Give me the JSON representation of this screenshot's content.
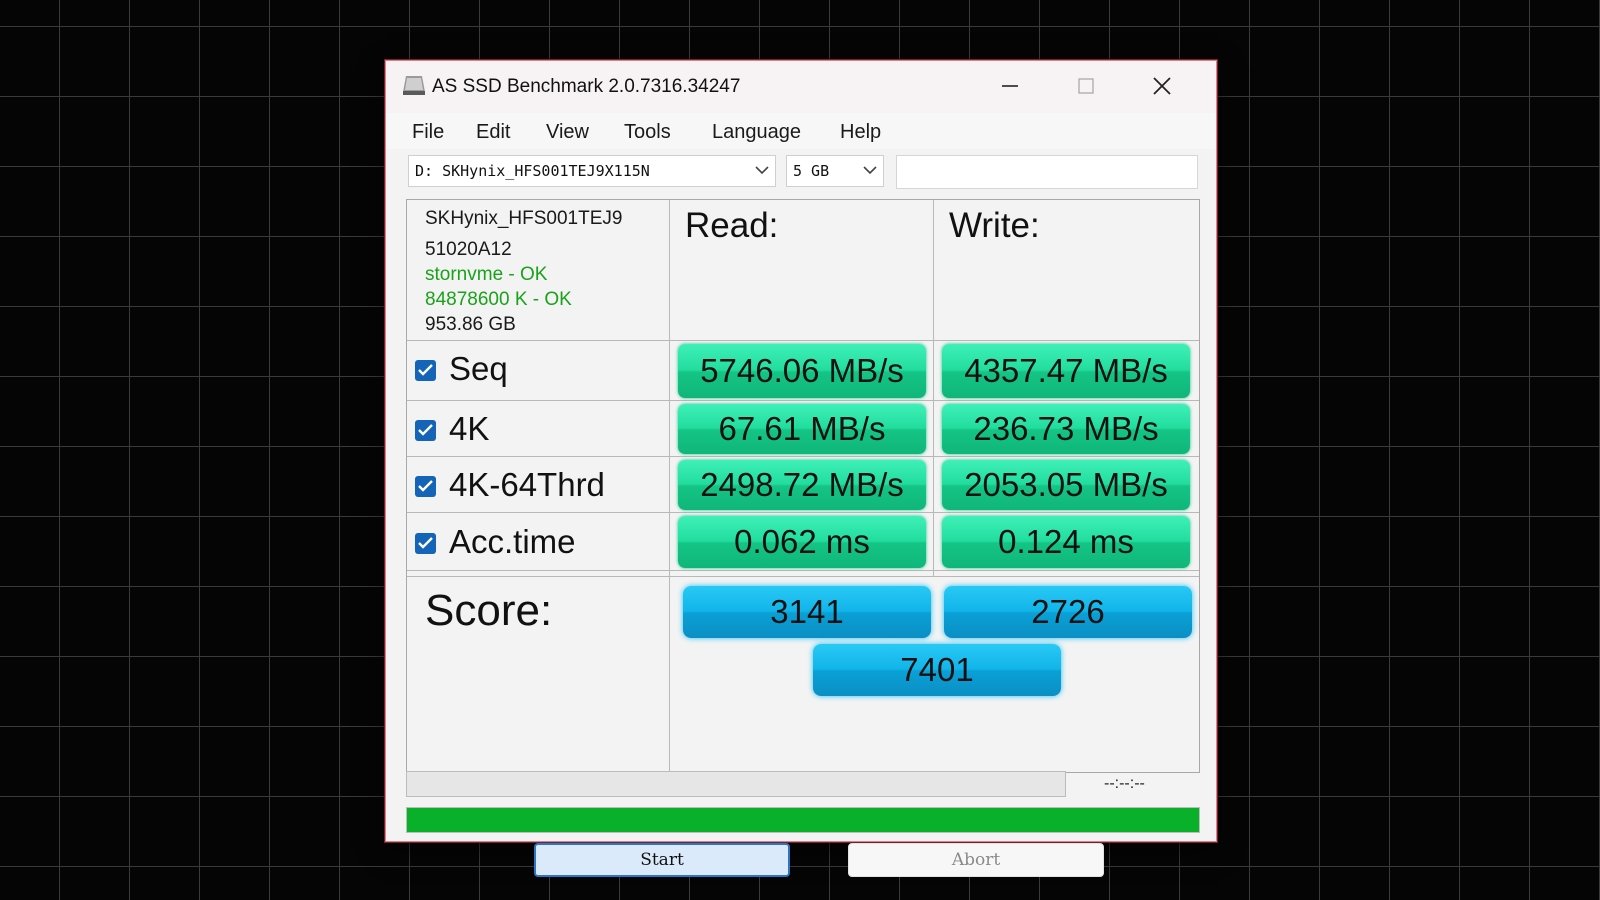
{
  "window": {
    "title": "AS SSD Benchmark 2.0.7316.34247",
    "controls": {
      "minimize": "minimize-icon",
      "maximize": "maximize-icon",
      "close": "close-icon"
    }
  },
  "menu": [
    "File",
    "Edit",
    "View",
    "Tools",
    "Language",
    "Help"
  ],
  "toolbar": {
    "drive_select": "D: SKHynix_HFS001TEJ9X115N",
    "size_select": "5 GB",
    "text_field": ""
  },
  "drive_info": {
    "model": "SKHynix_HFS001TEJ9",
    "firmware": "51020A12",
    "driver": "stornvme - OK",
    "alignment": "84878600 K - OK",
    "capacity": "953.86 GB"
  },
  "columns": {
    "read": "Read:",
    "write": "Write:"
  },
  "tests": [
    {
      "label": "Seq",
      "checked": true,
      "read": "5746.06 MB/s",
      "write": "4357.47 MB/s"
    },
    {
      "label": "4K",
      "checked": true,
      "read": "67.61 MB/s",
      "write": "236.73 MB/s"
    },
    {
      "label": "4K-64Thrd",
      "checked": true,
      "read": "2498.72 MB/s",
      "write": "2053.05 MB/s"
    },
    {
      "label": "Acc.time",
      "checked": true,
      "read": "0.062 ms",
      "write": "0.124 ms"
    }
  ],
  "score": {
    "label": "Score:",
    "read": "3141",
    "write": "2726",
    "total": "7401"
  },
  "progress": {
    "time": "--:--:--",
    "test_fraction": 0,
    "overall_fraction": 1
  },
  "buttons": {
    "start": "Start",
    "abort": "Abort"
  },
  "colors": {
    "result_green": "#22dd9e",
    "score_blue": "#12b5ea",
    "progress_green": "#09b02a",
    "ok_text": "#1aa21a",
    "checkbox": "#1464b8"
  }
}
